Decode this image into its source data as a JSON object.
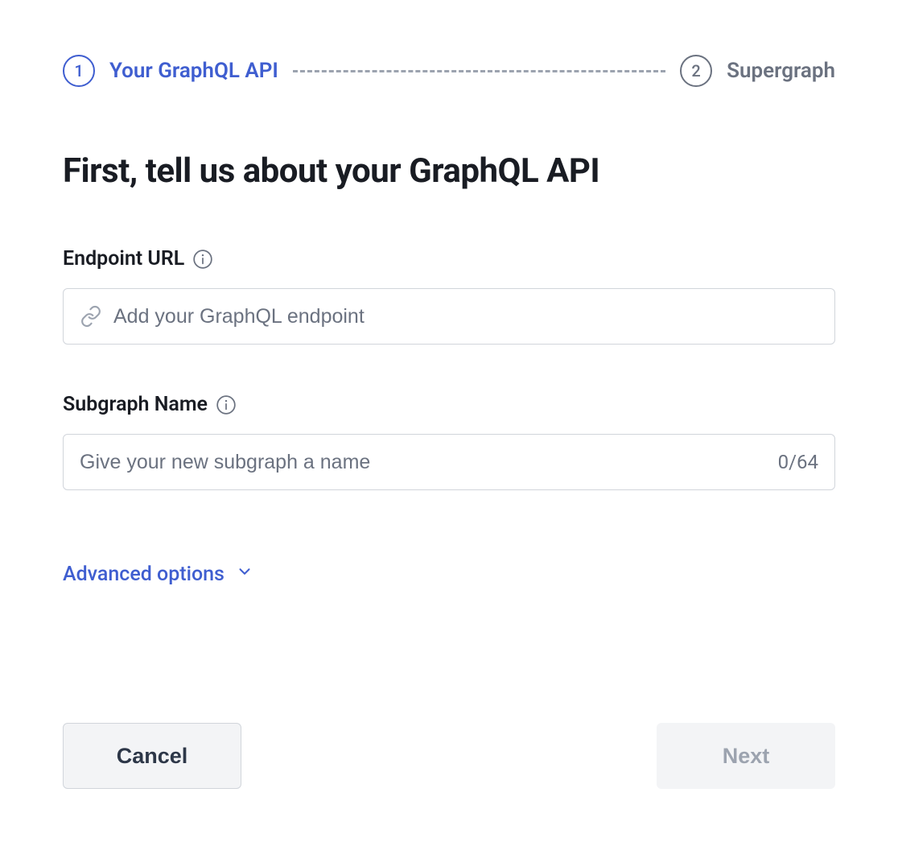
{
  "stepper": {
    "steps": [
      {
        "number": "1",
        "label": "Your GraphQL API",
        "active": true
      },
      {
        "number": "2",
        "label": "Supergraph",
        "active": false
      }
    ]
  },
  "heading": "First, tell us about your GraphQL API",
  "fields": {
    "endpoint": {
      "label": "Endpoint URL",
      "placeholder": "Add your GraphQL endpoint",
      "value": ""
    },
    "subgraph": {
      "label": "Subgraph Name",
      "placeholder": "Give your new subgraph a name",
      "value": "",
      "counter": "0/64"
    }
  },
  "advanced_options_label": "Advanced options",
  "buttons": {
    "cancel": "Cancel",
    "next": "Next"
  },
  "colors": {
    "accent": "#3f5ed0",
    "muted": "#6b7280",
    "border": "#d1d5db"
  }
}
